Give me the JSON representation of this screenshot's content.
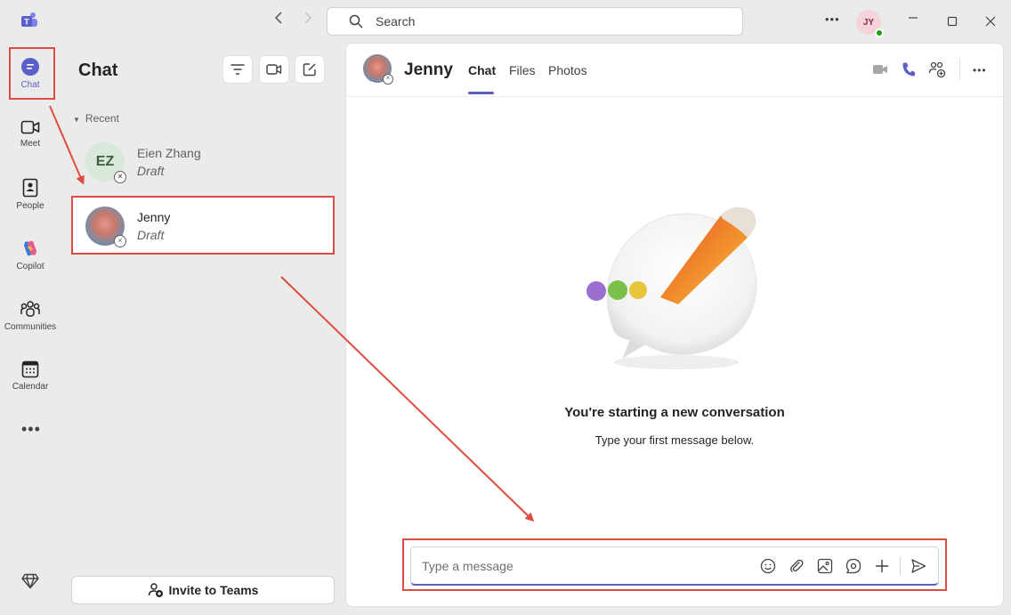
{
  "rail": {
    "items": [
      {
        "label": "Chat"
      },
      {
        "label": "Meet"
      },
      {
        "label": "People"
      },
      {
        "label": "Copilot"
      },
      {
        "label": "Communities"
      },
      {
        "label": "Calendar"
      }
    ]
  },
  "topbar": {
    "search_placeholder": "Search",
    "user_initials": "JY"
  },
  "chat_list": {
    "title": "Chat",
    "section": "Recent",
    "items": [
      {
        "initials": "EZ",
        "name": "Eien Zhang",
        "preview": "Draft"
      },
      {
        "name": "Jenny",
        "preview": "Draft"
      }
    ],
    "invite_label": "Invite to Teams"
  },
  "conversation": {
    "name": "Jenny",
    "tabs": [
      {
        "label": "Chat"
      },
      {
        "label": "Files"
      },
      {
        "label": "Photos"
      }
    ],
    "empty_title": "You're starting a new conversation",
    "empty_subtitle": "Type your first message below.",
    "compose_placeholder": "Type a message"
  },
  "colors": {
    "accent": "#5b5fc7",
    "annotation": "#e04b40",
    "presence": "#13a10e"
  }
}
